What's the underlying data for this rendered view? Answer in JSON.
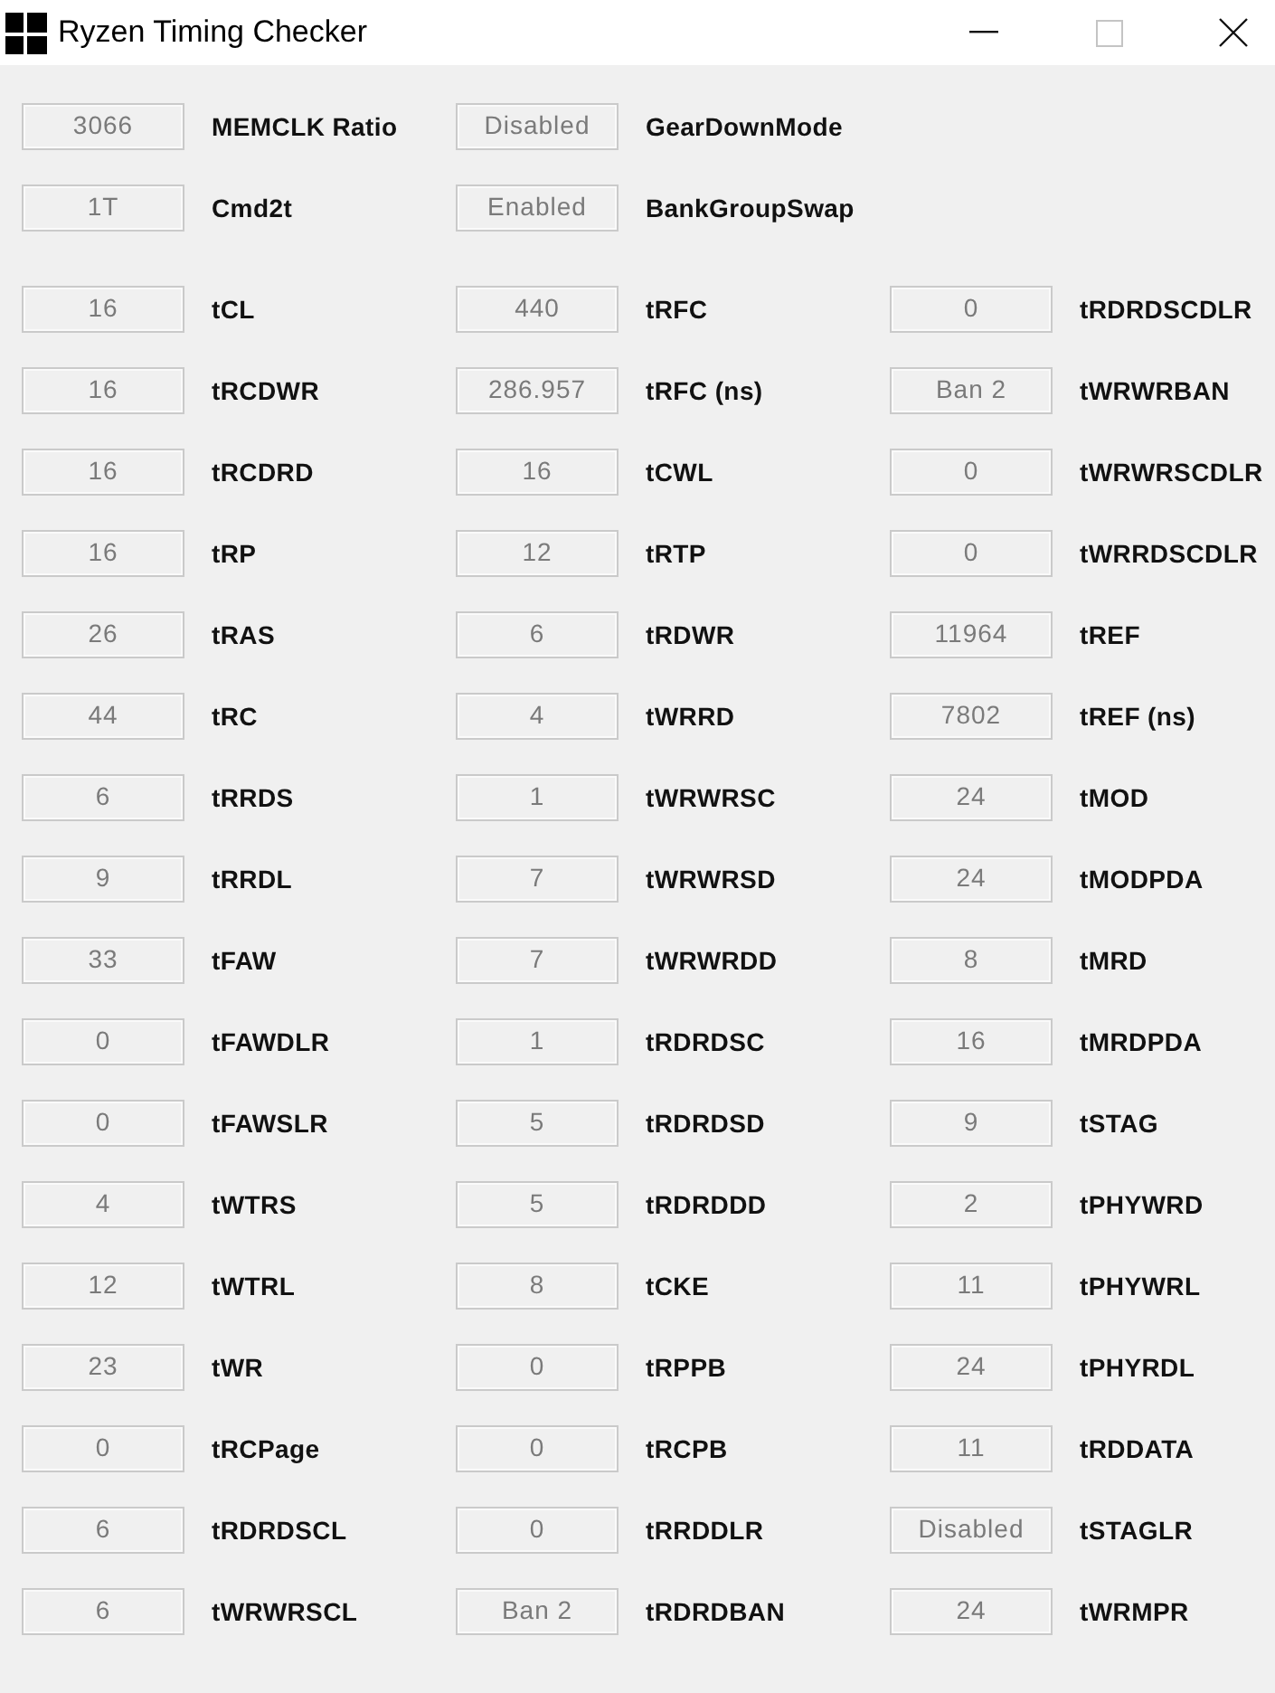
{
  "window": {
    "title": "Ryzen Timing Checker",
    "controls": [
      {
        "kind": "minimize",
        "disabled": false
      },
      {
        "kind": "maximize",
        "disabled": true
      },
      {
        "kind": "close",
        "disabled": false
      }
    ]
  },
  "general": [
    [
      {
        "value": "3066",
        "name": "MEMCLK Ratio",
        "disabled": true
      },
      {
        "value": "Disabled",
        "name": "GearDownMode",
        "disabled": true
      }
    ],
    [
      {
        "value": "1T",
        "name": "Cmd2t",
        "disabled": true
      },
      {
        "value": "Enabled",
        "name": "BankGroupSwap",
        "disabled": true
      }
    ]
  ],
  "timings": [
    [
      {
        "value": "16",
        "name": "tCL",
        "disabled": true
      },
      {
        "value": "440",
        "name": "tRFC",
        "disabled": true
      },
      {
        "value": "0",
        "name": "tRDRDSCDLR",
        "disabled": true
      }
    ],
    [
      {
        "value": "16",
        "name": "tRCDWR",
        "disabled": true
      },
      {
        "value": "286.957",
        "name": "tRFC (ns)",
        "disabled": true
      },
      {
        "value": "Ban 2",
        "name": "tWRWRBAN",
        "disabled": true
      }
    ],
    [
      {
        "value": "16",
        "name": "tRCDRD",
        "disabled": true
      },
      {
        "value": "16",
        "name": "tCWL",
        "disabled": true
      },
      {
        "value": "0",
        "name": "tWRWRSCDLR",
        "disabled": true
      }
    ],
    [
      {
        "value": "16",
        "name": "tRP",
        "disabled": true
      },
      {
        "value": "12",
        "name": "tRTP",
        "disabled": true
      },
      {
        "value": "0",
        "name": "tWRRDSCDLR",
        "disabled": true
      }
    ],
    [
      {
        "value": "26",
        "name": "tRAS",
        "disabled": true
      },
      {
        "value": "6",
        "name": "tRDWR",
        "disabled": true
      },
      {
        "value": "11964",
        "name": "tREF",
        "disabled": true
      }
    ],
    [
      {
        "value": "44",
        "name": "tRC",
        "disabled": true
      },
      {
        "value": "4",
        "name": "tWRRD",
        "disabled": true
      },
      {
        "value": "7802",
        "name": "tREF (ns)",
        "disabled": true
      }
    ],
    [
      {
        "value": "6",
        "name": "tRRDS",
        "disabled": true
      },
      {
        "value": "1",
        "name": "tWRWRSC",
        "disabled": true
      },
      {
        "value": "24",
        "name": "tMOD",
        "disabled": true
      }
    ],
    [
      {
        "value": "9",
        "name": "tRRDL",
        "disabled": true
      },
      {
        "value": "7",
        "name": "tWRWRSD",
        "disabled": true
      },
      {
        "value": "24",
        "name": "tMODPDA",
        "disabled": true
      }
    ],
    [
      {
        "value": "33",
        "name": "tFAW",
        "disabled": true
      },
      {
        "value": "7",
        "name": "tWRWRDD",
        "disabled": true
      },
      {
        "value": "8",
        "name": "tMRD",
        "disabled": true
      }
    ],
    [
      {
        "value": "0",
        "name": "tFAWDLR",
        "disabled": true
      },
      {
        "value": "1",
        "name": "tRDRDSC",
        "disabled": true
      },
      {
        "value": "16",
        "name": "tMRDPDA",
        "disabled": true
      }
    ],
    [
      {
        "value": "0",
        "name": "tFAWSLR",
        "disabled": true
      },
      {
        "value": "5",
        "name": "tRDRDSD",
        "disabled": true
      },
      {
        "value": "9",
        "name": "tSTAG",
        "disabled": true
      }
    ],
    [
      {
        "value": "4",
        "name": "tWTRS",
        "disabled": true
      },
      {
        "value": "5",
        "name": "tRDRDDD",
        "disabled": true
      },
      {
        "value": "2",
        "name": "tPHYWRD",
        "disabled": true
      }
    ],
    [
      {
        "value": "12",
        "name": "tWTRL",
        "disabled": true
      },
      {
        "value": "8",
        "name": "tCKE",
        "disabled": true
      },
      {
        "value": "11",
        "name": "tPHYWRL",
        "disabled": true
      }
    ],
    [
      {
        "value": "23",
        "name": "tWR",
        "disabled": true
      },
      {
        "value": "0",
        "name": "tRPPB",
        "disabled": true
      },
      {
        "value": "24",
        "name": "tPHYRDL",
        "disabled": true
      }
    ],
    [
      {
        "value": "0",
        "name": "tRCPage",
        "disabled": true
      },
      {
        "value": "0",
        "name": "tRCPB",
        "disabled": true
      },
      {
        "value": "11",
        "name": "tRDDATA",
        "disabled": true
      }
    ],
    [
      {
        "value": "6",
        "name": "tRDRDSCL",
        "disabled": true
      },
      {
        "value": "0",
        "name": "tRRDDLR",
        "disabled": true
      },
      {
        "value": "Disabled",
        "name": "tSTAGLR",
        "disabled": true
      }
    ],
    [
      {
        "value": "6",
        "name": "tWRWRSCL",
        "disabled": true
      },
      {
        "value": "Ban 2",
        "name": "tRDRDBAN",
        "disabled": true
      },
      {
        "value": "24",
        "name": "tWRMPR",
        "disabled": true
      }
    ]
  ]
}
